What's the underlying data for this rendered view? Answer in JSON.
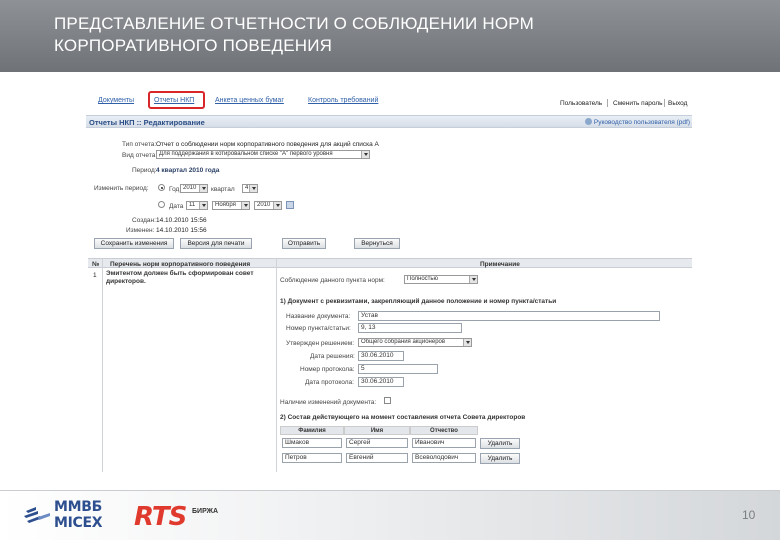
{
  "slide": {
    "title_line1": "ПРЕДСТАВЛЕНИЕ ОТЧЕТНОСТИ О СОБЛЮДЕНИИ НОРМ",
    "title_line2": "КОРПОРАТИВНОГО ПОВЕДЕНИЯ",
    "page_number": "10",
    "logo_micex_line1": "ММВБ",
    "logo_micex_line2": "MICEX",
    "logo_rts": "RTS",
    "logo_rts_sub": "БИРЖА",
    "highlight_color": "#d9262b"
  },
  "nav": {
    "tabs": [
      "Документы",
      "Отчеты НКП",
      "Анкета ценных бумаг",
      "Контроль требований"
    ],
    "user_links": [
      "Пользователь",
      "Сменить пароль",
      "Выход"
    ]
  },
  "titlebar": {
    "title": "Отчеты НКП :: Редактирование",
    "help": "Руководство пользователя (pdf)"
  },
  "form": {
    "report_type_label": "Тип отчета:",
    "report_type_value": "Отчет о соблюдении норм корпоративного поведения для акций списка А",
    "list_type_label": "Вид отчета:",
    "list_type_value": "Для поддержания в котировальном списке \"А\" первого уровня",
    "period_label": "Период:",
    "period_value": "4 квартал 2010 года",
    "change_period_label": "Изменить период:",
    "year_label": "Год",
    "year_value": "2010",
    "quarter_label": "квартал",
    "quarter_value": "4",
    "date_label": "Дата",
    "date_day": "11",
    "date_month": "Ноября",
    "date_year": "2010",
    "created_label": "Создан:",
    "created_value": "14.10.2010 15:56",
    "changed_label": "Изменен:",
    "changed_value": "14.10.2010 15:56"
  },
  "buttons": {
    "save": "Сохранить изменения",
    "print": "Версия для печати",
    "send": "Отправить",
    "back": "Вернуться"
  },
  "grid": {
    "col_num": "№",
    "col_norms": "Перечень норм корпоративного поведения",
    "col_note": "Примечание",
    "row_num": "1",
    "row_text": "Эмитентом должен быть сформирован совет директоров.",
    "compliance_label": "Соблюдение данного пункта норм:",
    "compliance_value": "Полностью"
  },
  "section1": {
    "title": "1) Документ с реквизитами, закрепляющий данное положение и номер пункта/статьи",
    "doc_name_label": "Название документа:",
    "doc_name_value": "Устав",
    "clause_label": "Номер пункта/статьи:",
    "clause_value": "9, 13",
    "approved_label": "Утвержден решением:",
    "approved_value": "Общего собрания акционеров",
    "decision_date_label": "Дата решения:",
    "decision_date_value": "30.06.2010",
    "protocol_num_label": "Номер протокола:",
    "protocol_num_value": "5",
    "protocol_date_label": "Дата протокола:",
    "protocol_date_value": "30.06.2010",
    "changes_label": "Наличие изменений документа:"
  },
  "section2": {
    "title": "2) Состав действующего на момент составления отчета Совета директоров",
    "headers": [
      "Фамилия",
      "Имя",
      "Отчество"
    ],
    "rows": [
      {
        "last": "Шмаков",
        "first": "Сергей",
        "middle": "Иванович",
        "action": "Удалить"
      },
      {
        "last": "Петров",
        "first": "Евгений",
        "middle": "Всеволодович",
        "action": "Удалить"
      }
    ]
  }
}
